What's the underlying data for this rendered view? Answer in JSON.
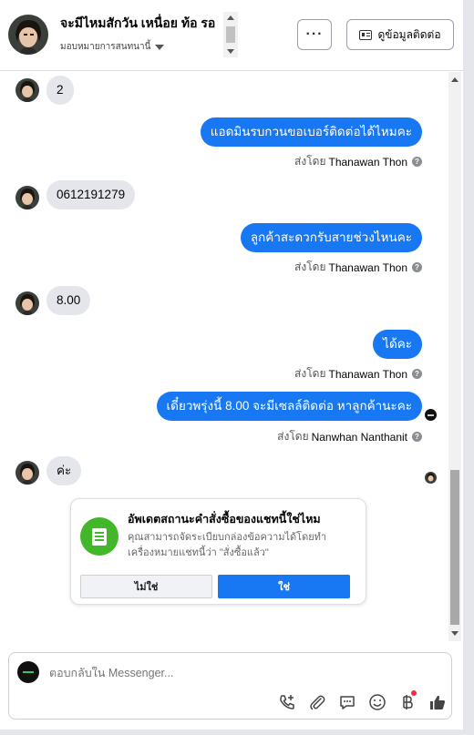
{
  "header": {
    "title": "จะมีไหมสักวัน เหนื่อย ท้อ รอ",
    "subtitle": "มอบหมายการสนทนานี้",
    "more_label": "···",
    "contact_button": "ดูข้อมูลติดต่อ",
    "icons": {
      "more": "more-dots-icon",
      "contact": "contact-card-icon",
      "assign": "caret-down-icon"
    }
  },
  "messages": [
    {
      "direction": "in",
      "text": "2"
    },
    {
      "direction": "out",
      "text": "แอดมินรบกวนขอเบอร์ติดต่อได้ไหมคะ",
      "sent_by_label": "ส่งโดย",
      "sender": "Thanawan Thon"
    },
    {
      "direction": "in",
      "text": "0612191279"
    },
    {
      "direction": "out",
      "text": "ลูกค้าสะดวกรับสายช่วงไหนคะ",
      "sent_by_label": "ส่งโดย",
      "sender": "Thanawan Thon"
    },
    {
      "direction": "in",
      "text": "8.00"
    },
    {
      "direction": "out",
      "text": "ได้คะ",
      "sent_by_label": "ส่งโดย",
      "sender": "Thanawan Thon"
    },
    {
      "direction": "out",
      "text": "เดี๋ยวพรุ่งนี้ 8.00 จะมีเซลล์ติดต่อ หาลูกค้านะคะ",
      "sent_by_label": "ส่งโดย",
      "sender": "Nanwhan Nanthanit"
    },
    {
      "direction": "in",
      "text": "ค่ะ"
    }
  ],
  "prompt_card": {
    "title": "อัพเดตสถานะคำสั่งซื้อของแชทนี้ใช่ไหม",
    "text": "คุณสามารถจัดระเบียบกล่องข้อความได้โดยทำเครื่องหมายแชทนี้ว่า \"สั่งซื้อแล้ว\"",
    "no_label": "ไม่ใช่",
    "yes_label": "ใช่",
    "icon": "order-document-icon",
    "icon_color": "#42b72a"
  },
  "composer": {
    "placeholder": "ตอบกลับใน Messenger...",
    "tools": [
      "phone-add-icon",
      "attachment-icon",
      "saved-replies-icon",
      "emoji-icon",
      "payment-icon",
      "like-icon"
    ]
  },
  "colors": {
    "outgoing_bubble": "#1877f2",
    "incoming_bubble": "#e4e6eb",
    "notification_dot": "#f02849"
  }
}
